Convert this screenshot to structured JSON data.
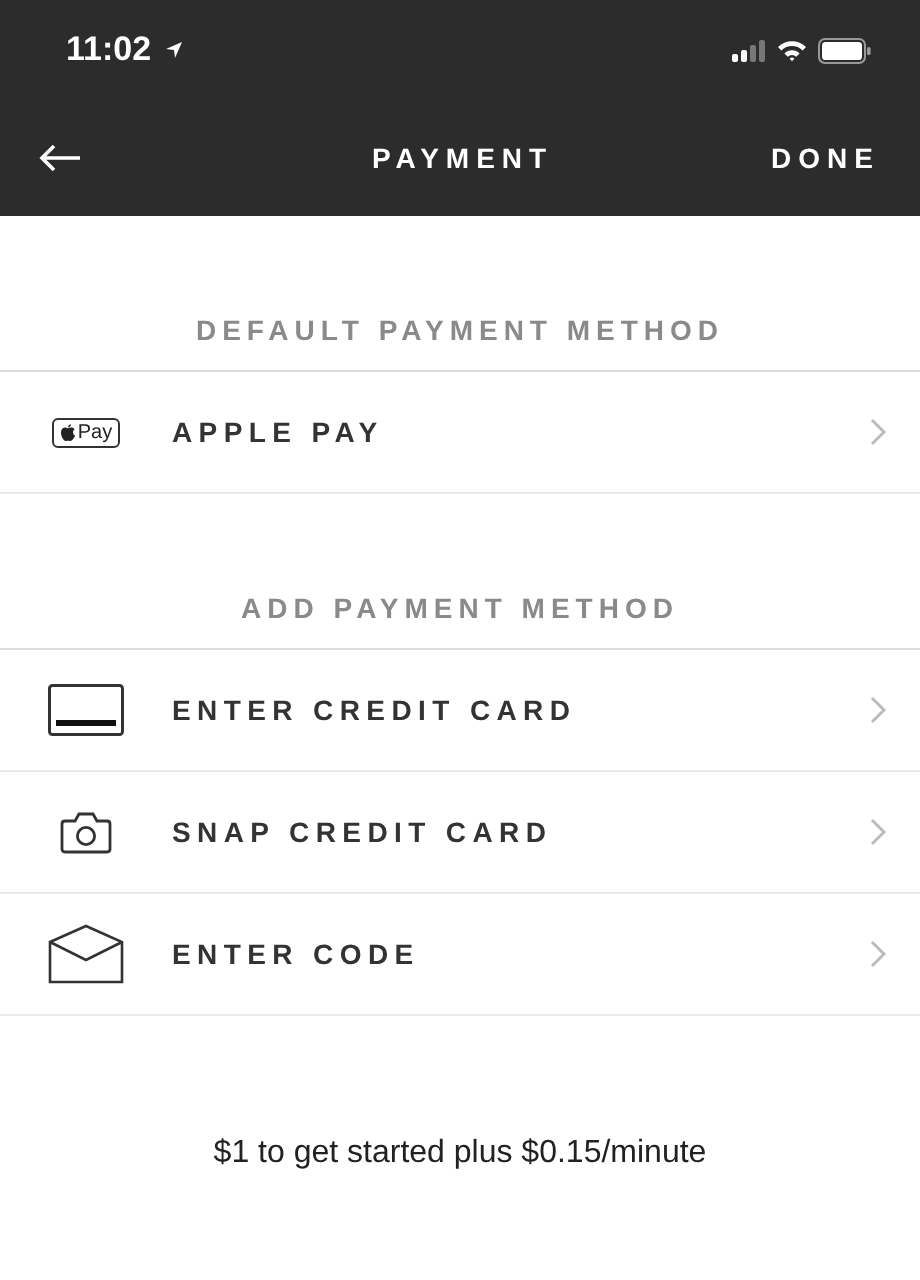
{
  "status_bar": {
    "time": "11:02"
  },
  "nav": {
    "title": "PAYMENT",
    "done": "DONE"
  },
  "sections": [
    {
      "header": "DEFAULT PAYMENT METHOD",
      "items": [
        {
          "kind": "applepay",
          "label": "APPLE PAY",
          "badge": "Pay"
        }
      ]
    },
    {
      "header": "ADD PAYMENT METHOD",
      "items": [
        {
          "kind": "card",
          "label": "ENTER CREDIT CARD"
        },
        {
          "kind": "camera",
          "label": "SNAP CREDIT CARD"
        },
        {
          "kind": "envelope",
          "label": "ENTER CODE"
        }
      ]
    }
  ],
  "footer": "$1 to get started plus $0.15/minute"
}
